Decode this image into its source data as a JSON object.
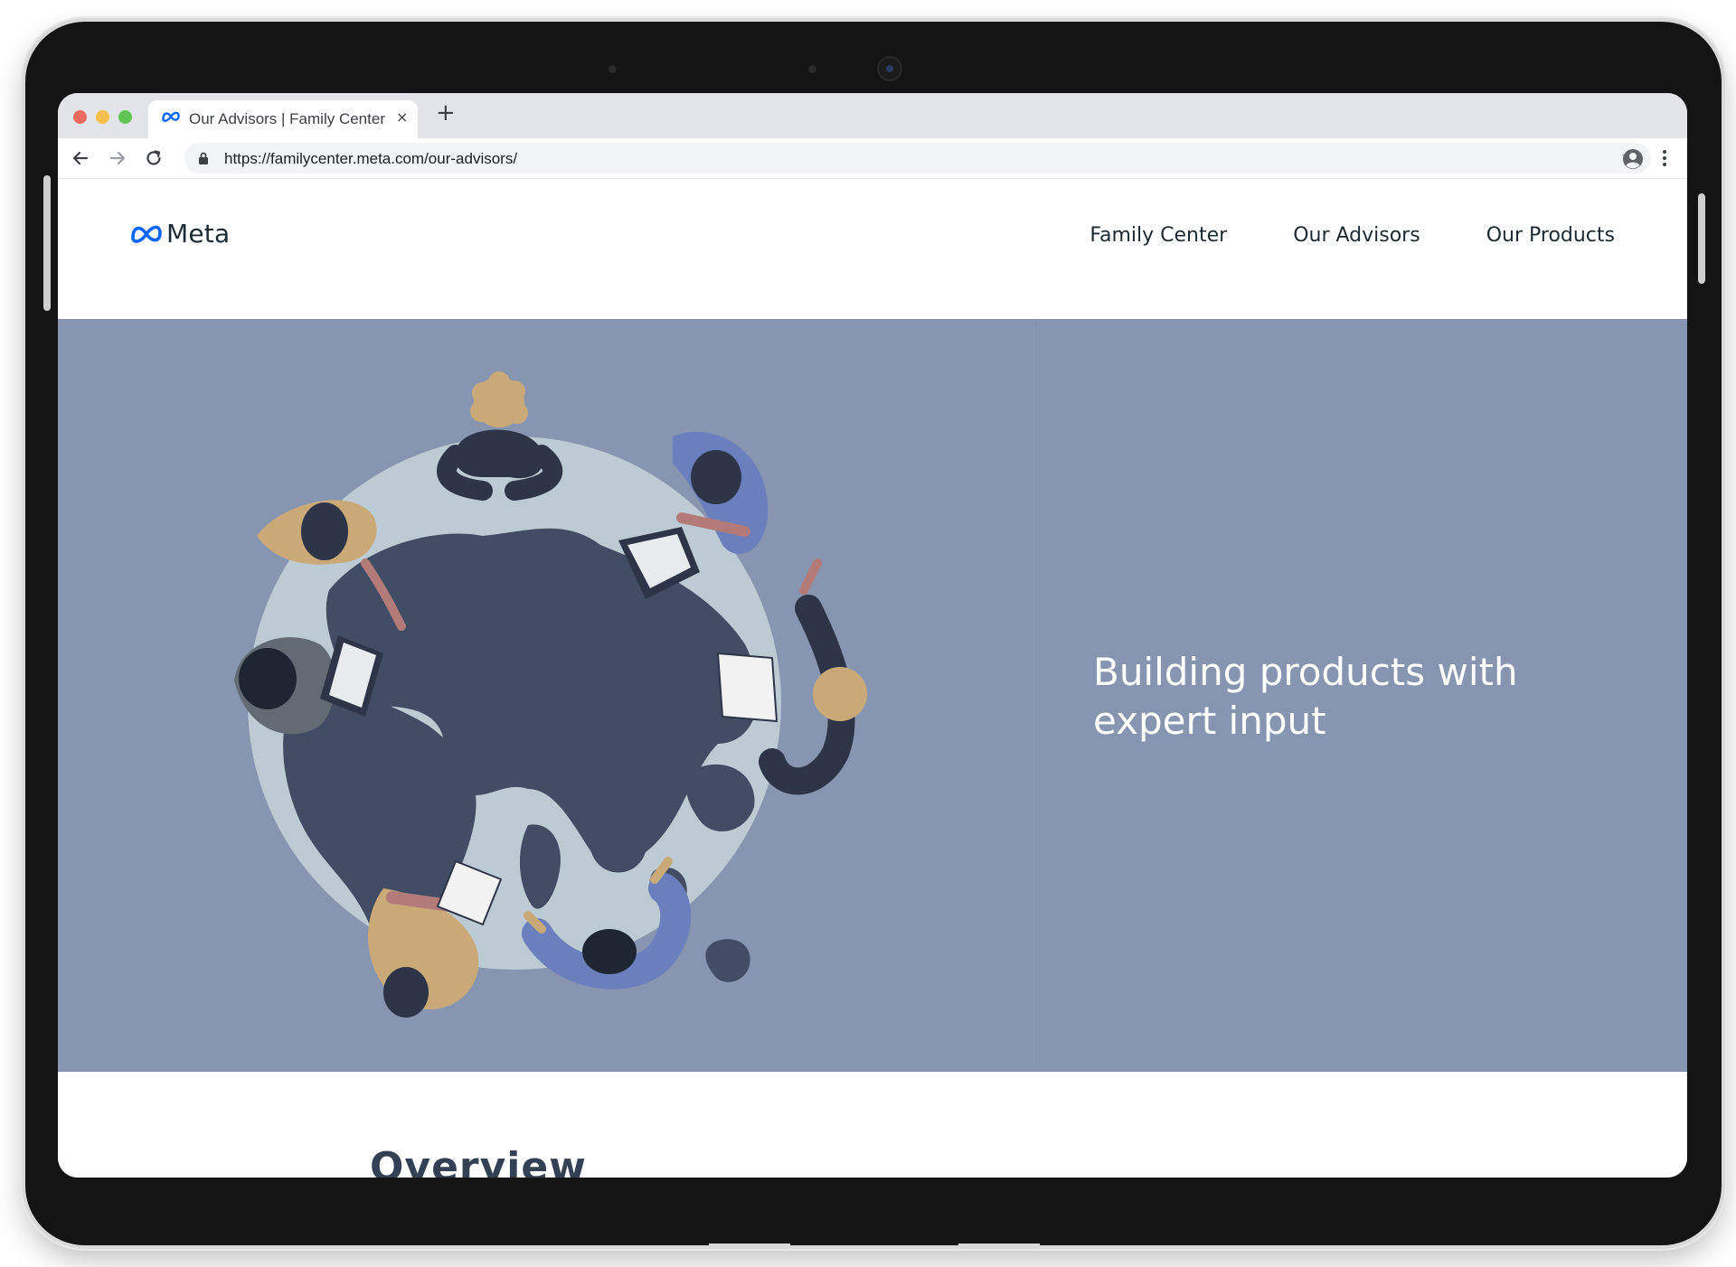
{
  "browser": {
    "tab_title": "Our Advisors | Family Center",
    "tab_close": "×",
    "new_tab": "+",
    "url": "https://familycenter.meta.com/our-advisors/"
  },
  "header": {
    "logo_text": "Meta",
    "nav": [
      "Family Center",
      "Our Advisors",
      "Our Products"
    ]
  },
  "hero": {
    "title": "Building products with expert input",
    "background_color": "#8795b1"
  },
  "overview": {
    "title": "Overview"
  },
  "colors": {
    "meta_blue": "#0866ff",
    "text_dark": "#1c2b33",
    "globe_land": "#424c65",
    "globe_water": "#bccbd3"
  },
  "icons": [
    "back-arrow-icon",
    "forward-arrow-icon",
    "reload-icon",
    "lock-icon",
    "star-icon",
    "profile-icon",
    "more-menu-icon",
    "meta-infinity-icon"
  ]
}
